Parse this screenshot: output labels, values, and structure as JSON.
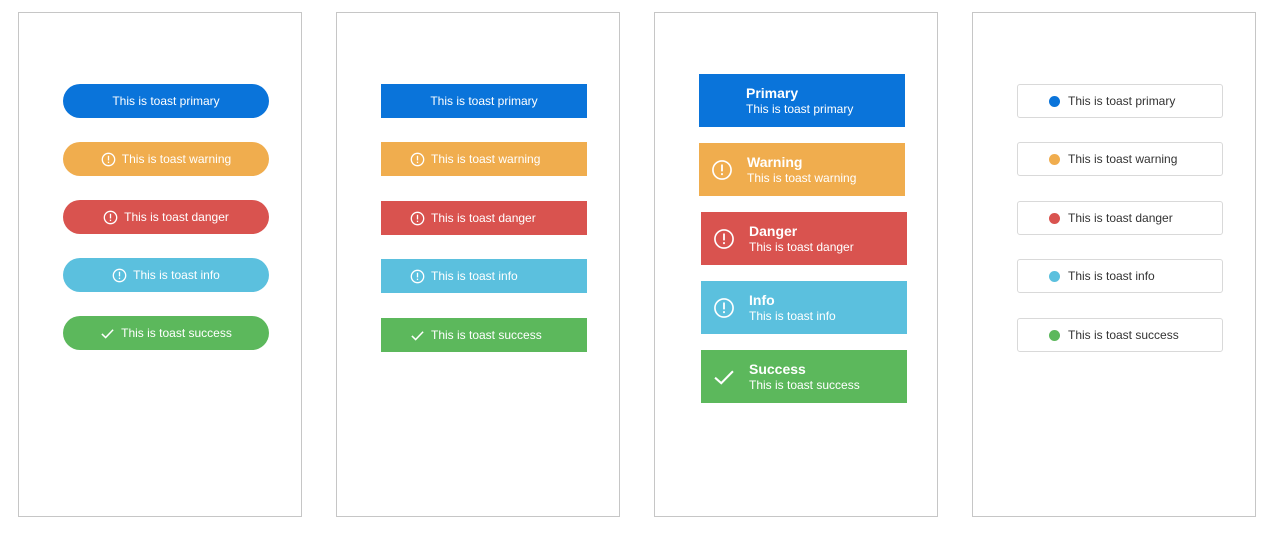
{
  "colors": {
    "primary": "#0a74da",
    "warning": "#f0ad4e",
    "danger": "#d9534f",
    "info": "#5bc0de",
    "success": "#5cb85c"
  },
  "toasts": {
    "primary": "This is toast primary",
    "warning": "This is toast warning",
    "danger": "This is toast danger",
    "info": "This is toast info",
    "success": "This is toast success"
  },
  "titles": {
    "primary": "Primary",
    "warning": "Warning",
    "danger": "Danger",
    "info": "Info",
    "success": "Success"
  },
  "icons": {
    "warning": "alert-circle-icon",
    "danger": "alert-circle-icon",
    "info": "alert-circle-icon",
    "success": "checkmark-icon"
  }
}
